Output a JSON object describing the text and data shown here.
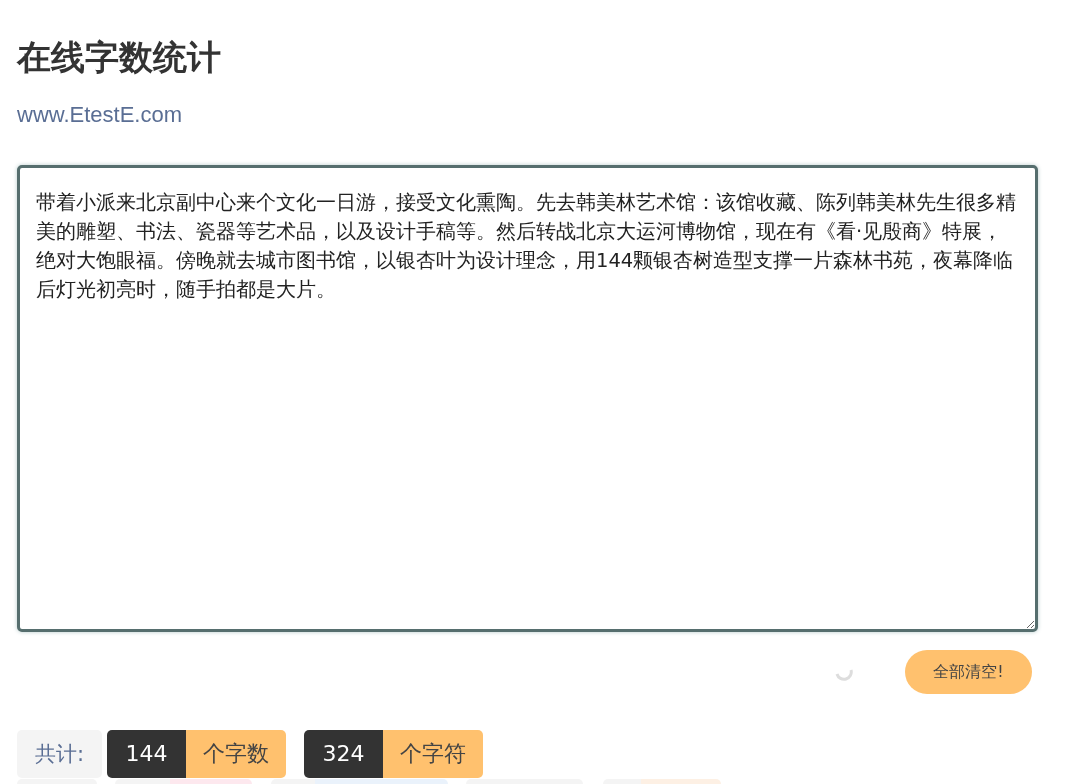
{
  "header": {
    "title": "在线字数统计",
    "site": "www.EtestE.com"
  },
  "editor": {
    "value": "带着小派来北京副中心来个文化一日游，接受文化熏陶。先去韩美林艺术馆：该馆收藏、陈列韩美林先生很多精美的雕塑、书法、瓷器等艺术品，以及设计手稿等。然后转战北京大运河博物馆，现在有《看·见殷商》特展，绝对大饱眼福。傍晚就去城市图书馆，以银杏叶为设计理念，用144颗银杏树造型支撑一片森林书苑，夜幕降临后灯光初亮时，随手拍都是大片。"
  },
  "clear_button": "全部清空!",
  "stats": {
    "label": "共计:",
    "items": [
      {
        "count": "144",
        "unit": "个字数"
      },
      {
        "count": "324",
        "unit": "个字符"
      }
    ]
  }
}
